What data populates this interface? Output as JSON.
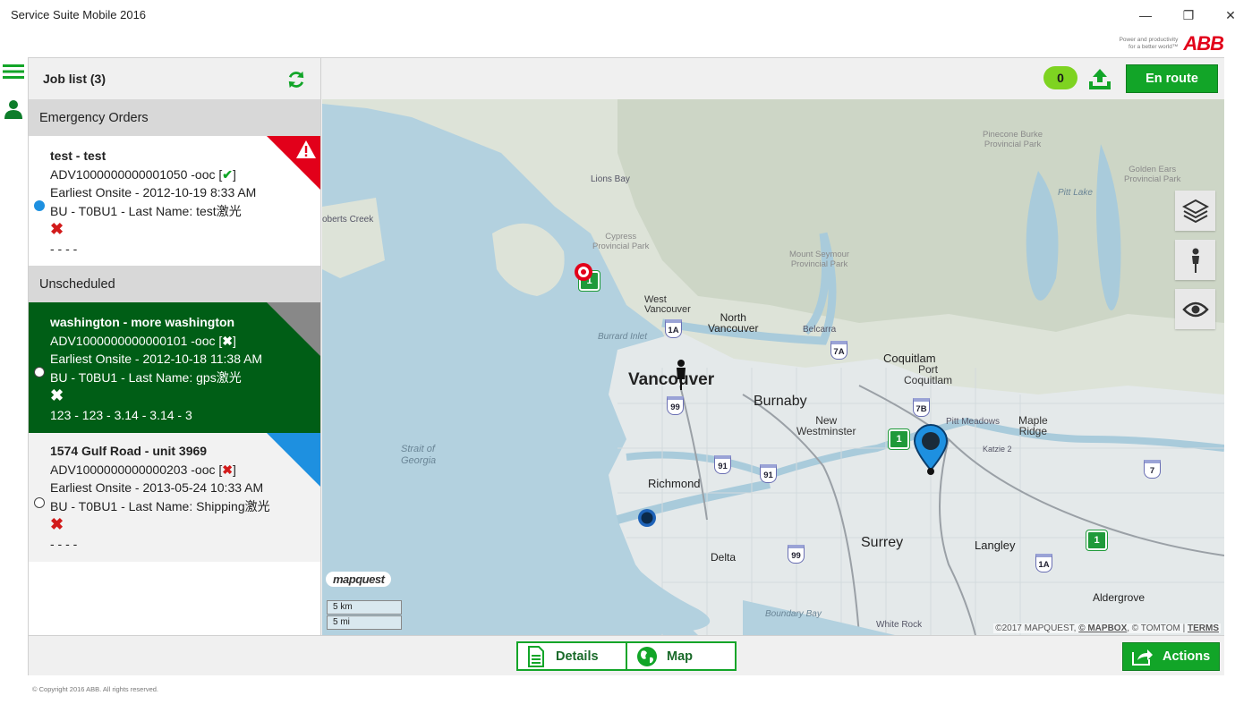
{
  "window": {
    "title": "Service Suite Mobile 2016",
    "minimize_glyph": "—",
    "restore_glyph": "❐",
    "close_glyph": "✕"
  },
  "brand": {
    "tagline_1": "Power and productivity",
    "tagline_2": "for a better world™",
    "logo_text": "ABB"
  },
  "joblist": {
    "title": "Job list (3)",
    "sections": {
      "emergency": "Emergency Orders",
      "unscheduled": "Unscheduled"
    },
    "jobs": [
      {
        "name": "test - test",
        "id": "ADV1000000000001050 -ooc [",
        "id_close": "]",
        "onsite": "Earliest Onsite - 2012-10-19 8:33 AM",
        "bu": "BU - T0BU1 - Last Name: test激光",
        "extra": "- - - -",
        "accent": "#e2001a"
      },
      {
        "name": "washington - more washington",
        "id": "ADV1000000000000101 -ooc [",
        "id_close": "]",
        "onsite": "Earliest Onsite - 2012-10-18 11:38 AM",
        "bu": "BU - T0BU1 - Last Name: gps激光",
        "extra": "123 - 123 - 3.14 - 3.14 - 3",
        "accent": "#888888"
      },
      {
        "name": "1574 Gulf Road - unit 3969",
        "id": "ADV1000000000000203 -ooc [",
        "id_close": "]",
        "onsite": "Earliest Onsite - 2013-05-24 10:33 AM",
        "bu": "BU - T0BU1 - Last Name: Shipping激光",
        "extra": "- - - -",
        "accent": "#1e90e0"
      }
    ]
  },
  "topbar": {
    "count": "0",
    "enroute_label": "En route"
  },
  "map": {
    "labels": {
      "lions_bay": "Lions Bay",
      "cypress": "Cypress\nProvincial Park",
      "mount_seymour": "Mount Seymour\nProvincial Park",
      "pinecone": "Pinecone Burke\nProvincial Park",
      "golden_ears": "Golden Ears\nProvincial Park",
      "pitt_lake": "Pitt Lake",
      "roberts_creek": "oberts Creek",
      "west_vancouver": "West\nVancouver",
      "north_vancouver": "North\nVancouver",
      "burrard_inlet": "Burrard Inlet",
      "belcarra": "Belcarra",
      "vancouver": "Vancouver",
      "coquitlam": "Coquitlam",
      "port_coquitlam": "Port\nCoquitlam",
      "burnaby": "Burnaby",
      "new_westminster": "New\nWestminster",
      "pitt_meadows": "Pitt Meadows",
      "maple_ridge": "Maple\nRidge",
      "katzie": "Katzie 2",
      "strait": "Strait of\nGeorgia",
      "richmond": "Richmond",
      "surrey": "Surrey",
      "langley": "Langley",
      "delta": "Delta",
      "aldergrove": "Aldergrove",
      "boundary_bay": "Boundary Bay",
      "white_rock": "White Rock"
    },
    "shields": [
      "1A",
      "99",
      "7A",
      "7B",
      "91",
      "91",
      "99",
      "1A",
      "7"
    ],
    "green_shields": [
      "1",
      "1",
      "1"
    ],
    "logo": "mapquest",
    "scale_km": "5 km",
    "scale_mi": "5 mi",
    "attribution_prefix": "©2017 MAPQUEST, ",
    "attribution_mapbox": "© MAPBOX",
    "attribution_mid": ", © TOMTOM | ",
    "attribution_terms": "TERMS"
  },
  "bottom": {
    "details_label": "Details",
    "map_label": "Map",
    "actions_label": "Actions"
  },
  "footer": {
    "copyright": "© Copyright 2016 ABB. All rights reserved."
  },
  "colors": {
    "accent_green": "#12a528",
    "selected_row": "#005e16",
    "emergency": "#e2001a",
    "scheduled": "#1e90e0",
    "counter": "#7ed321"
  }
}
